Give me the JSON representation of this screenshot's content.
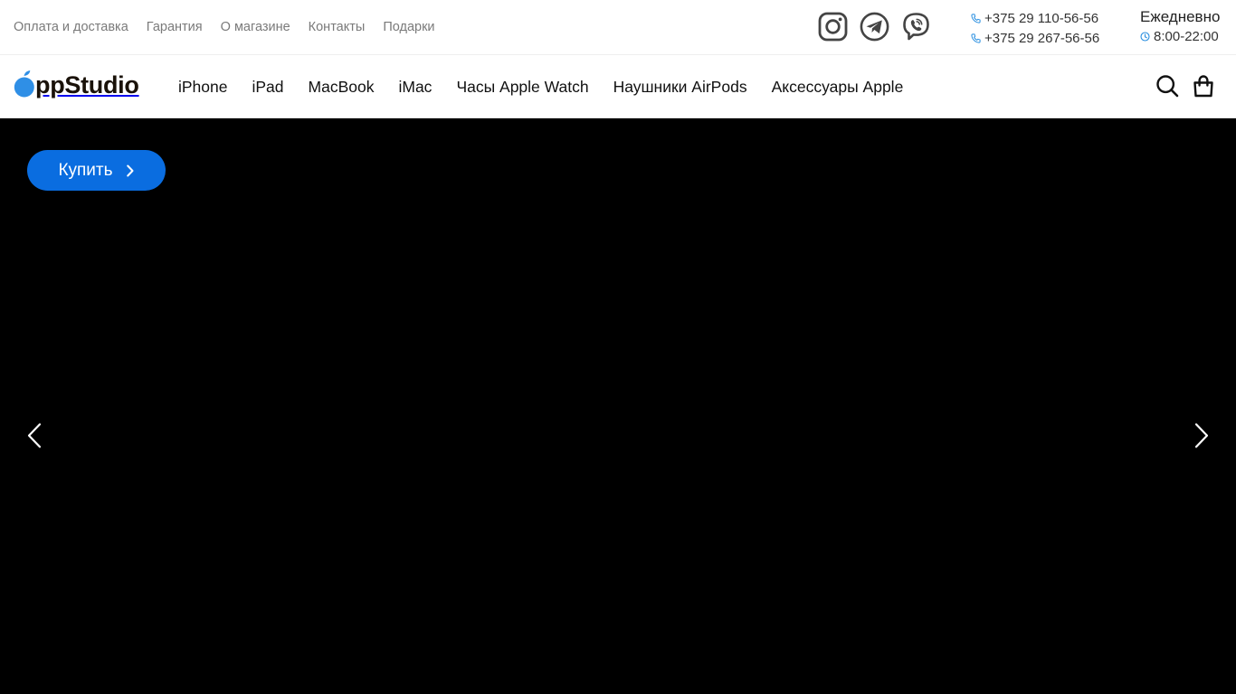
{
  "topbar": {
    "links": [
      "Оплата и доставка",
      "Гарантия",
      "О магазине",
      "Контакты",
      "Подарки"
    ],
    "socials": [
      "instagram-icon",
      "telegram-icon",
      "viber-icon"
    ],
    "phones": [
      "+375 29 110-56-56",
      "+375 29 267-56-56"
    ],
    "hours_days": "Ежедневно",
    "hours_time": "8:00-22:00"
  },
  "nav": {
    "logo_text": "ppStudio",
    "menu": [
      "iPhone",
      "iPad",
      "MacBook",
      "iMac",
      "Часы Apple Watch",
      "Наушники AirPods",
      "Аксессуары Apple"
    ],
    "icons": [
      "search-icon",
      "shopping-bag-icon"
    ]
  },
  "hero": {
    "buy_label": "Купить",
    "icons": [
      "chevron-left-icon",
      "chevron-right-icon"
    ]
  },
  "colors": {
    "accent": "#0a6de0",
    "phone_icon": "#2a8fe0",
    "logo_blue": "#2f8fe6",
    "hero_bg": "#000000"
  }
}
